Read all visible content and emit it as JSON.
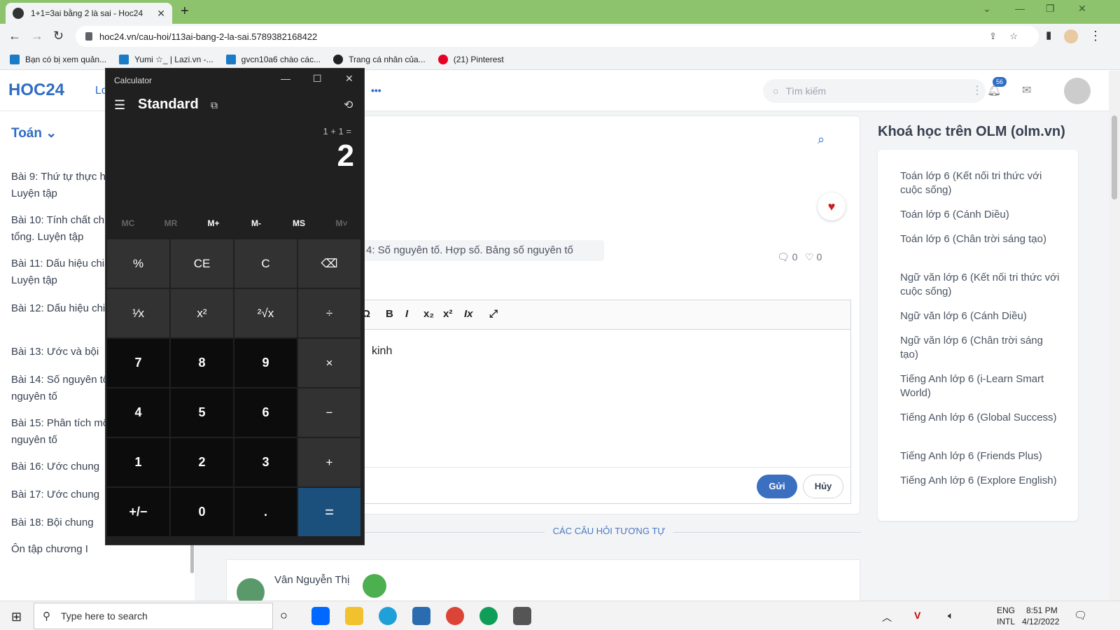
{
  "browser": {
    "tab_title": "1+1=3ai bằng 2 là sai - Hoc24",
    "tab_close": "✕",
    "new_tab": "+",
    "url": "hoc24.vn/cau-hoi/113ai-bang-2-la-sai.5789382168422",
    "bookmarks": [
      "Bạn có bị xem quản...",
      "Yumi ☆_ | Lazi.vn -...",
      "gvcn10a6 chào các...",
      "Trang cá nhân của...",
      "(21) Pinterest"
    ],
    "window_controls": [
      "⌄",
      "—",
      "❐",
      "✕"
    ],
    "colors": {
      "frame": "#8cc36c",
      "accent": "#2f6cc4"
    }
  },
  "site": {
    "logo": "HOC24",
    "nav_partial": "Lo",
    "more_dots": "•••",
    "search_placeholder": "Tìm kiếm",
    "notification_count": "56"
  },
  "sidebar": {
    "subject": "Toán",
    "lessons": [
      "Bài 9: Thứ tự thực hiện các phép tính. Luyện tập",
      "Bài 10: Tính chất chia hết của một tổng. Luyện tập",
      "Bài 11: Dấu hiệu chia hết cho 2, cho 5. Luyện tập",
      "Bài 12: Dấu hiệu chia hết cho 3, cho 9",
      "Bài 13: Ước và bội",
      "Bài 14: Số nguyên tố. Hợp số. Bảng số nguyên tố",
      "Bài 15: Phân tích một số ra thừa số nguyên tố",
      "Bài 16: Ước chung",
      "Bài 17: Ước chung",
      "Bài 18: Bội chung",
      "Ôn tập chương I"
    ]
  },
  "question": {
    "tag": "4: Số nguyên tố. Hợp số. Bảng số nguyên tố",
    "comments": "0",
    "likes": "0",
    "editor_text": "kinh",
    "send": "Gửi",
    "cancel": "Hủy",
    "similar": "CÁC CÂU HỎI TƯƠNG TỰ",
    "answer_author": "Vân Nguyễn Thị"
  },
  "courses": {
    "heading": "Khoá học trên OLM (olm.vn)",
    "items": [
      "Toán lớp 6 (Kết nối tri thức với cuộc sống)",
      "Toán lớp 6 (Cánh Diều)",
      "Toán lớp 6 (Chân trời sáng tạo)",
      "Ngữ văn lớp 6 (Kết nối tri thức với cuộc sống)",
      "Ngữ văn lớp 6 (Cánh Diều)",
      "Ngữ văn lớp 6 (Chân trời sáng tạo)",
      "Tiếng Anh lớp 6 (i-Learn Smart World)",
      "Tiếng Anh lớp 6 (Global Success)",
      "Tiếng Anh lớp 6 (Friends Plus)",
      "Tiếng Anh lớp 6 (Explore English)"
    ]
  },
  "calculator": {
    "title": "Calculator",
    "mode": "Standard",
    "expression": "1 + 1 =",
    "result": "2",
    "memory": [
      "MC",
      "MR",
      "M+",
      "M-",
      "MS",
      "M˅"
    ],
    "keys": [
      [
        "%",
        "CE",
        "C",
        "⌫"
      ],
      [
        "¹⁄x",
        "x²",
        "²√x",
        "÷"
      ],
      [
        "7",
        "8",
        "9",
        "×"
      ],
      [
        "4",
        "5",
        "6",
        "−"
      ],
      [
        "1",
        "2",
        "3",
        "+"
      ],
      [
        "+/−",
        "0",
        ".",
        "="
      ]
    ]
  },
  "taskbar": {
    "search_placeholder": "Type here to search",
    "lang": "ENG",
    "layout": "INTL",
    "time": "8:51 PM",
    "date": "4/12/2022"
  }
}
